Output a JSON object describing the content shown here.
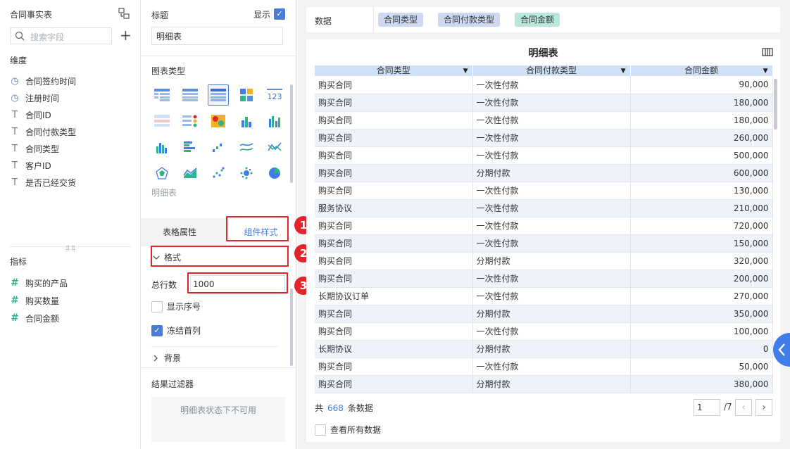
{
  "left": {
    "header": "合同事实表",
    "search_placeholder": "搜索字段",
    "dimensions_label": "维度",
    "dimensions": [
      {
        "icon": "clock-icon",
        "label": "合同签约时间"
      },
      {
        "icon": "clock-icon",
        "label": "注册时间"
      },
      {
        "icon": "text-type-icon",
        "label": "合同ID"
      },
      {
        "icon": "text-type-icon",
        "label": "合同付款类型"
      },
      {
        "icon": "text-type-icon",
        "label": "合同类型"
      },
      {
        "icon": "text-type-icon",
        "label": "客户ID"
      },
      {
        "icon": "text-type-icon",
        "label": "是否已经交货"
      }
    ],
    "metrics_label": "指标",
    "metrics": [
      {
        "icon": "hash-icon",
        "label": "购买的产品"
      },
      {
        "icon": "hash-icon",
        "label": "购买数量"
      },
      {
        "icon": "hash-icon",
        "label": "合同金额"
      }
    ]
  },
  "config": {
    "title_label": "标题",
    "show_label": "显示",
    "show_checked": true,
    "title_value": "明细表",
    "chart_type_label": "图表类型",
    "selected_chart_caption": "明细表",
    "tabs": [
      "表格属性",
      "组件样式"
    ],
    "active_tab": 1,
    "format_label": "格式",
    "total_rows_label": "总行数",
    "total_rows_value": "1000",
    "show_index_label": "显示序号",
    "show_index_checked": false,
    "freeze_first_col_label": "冻结首列",
    "freeze_first_col_checked": true,
    "background_label": "背景",
    "result_filter_label": "结果过滤器",
    "result_filter_msg": "明细表状态下不可用",
    "callouts": [
      "1",
      "2",
      "3"
    ],
    "highlight_color": "#e0262c"
  },
  "data_bar": {
    "label": "数据",
    "chips": [
      {
        "label": "合同类型",
        "color": "#cdd9f1"
      },
      {
        "label": "合同付款类型",
        "color": "#cdd9f1"
      },
      {
        "label": "合同金额",
        "color": "#b9e6dd"
      }
    ]
  },
  "table": {
    "title": "明细表",
    "columns": [
      "合同类型",
      "合同付款类型",
      "合同金额"
    ],
    "rows": [
      [
        "购买合同",
        "一次性付款",
        "90,000"
      ],
      [
        "购买合同",
        "一次性付款",
        "180,000"
      ],
      [
        "购买合同",
        "一次性付款",
        "180,000"
      ],
      [
        "购买合同",
        "一次性付款",
        "260,000"
      ],
      [
        "购买合同",
        "一次性付款",
        "500,000"
      ],
      [
        "购买合同",
        "分期付款",
        "600,000"
      ],
      [
        "购买合同",
        "一次性付款",
        "130,000"
      ],
      [
        "服务协议",
        "一次性付款",
        "210,000"
      ],
      [
        "购买合同",
        "一次性付款",
        "720,000"
      ],
      [
        "购买合同",
        "一次性付款",
        "150,000"
      ],
      [
        "购买合同",
        "分期付款",
        "320,000"
      ],
      [
        "购买合同",
        "一次性付款",
        "200,000"
      ],
      [
        "长期协议订单",
        "一次性付款",
        "270,000"
      ],
      [
        "购买合同",
        "分期付款",
        "350,000"
      ],
      [
        "购买合同",
        "一次性付款",
        "100,000"
      ],
      [
        "长期协议",
        "分期付款",
        "0"
      ],
      [
        "购买合同",
        "一次性付款",
        "50,000"
      ],
      [
        "购买合同",
        "分期付款",
        "380,000"
      ]
    ],
    "total_prefix": "共",
    "total_count": "668",
    "total_suffix": "条数据",
    "page_value": "1",
    "page_total": "/7",
    "view_all_label": "查看所有数据",
    "header_color": "#cfe0f7",
    "accent_color": "#4a7bd6"
  }
}
